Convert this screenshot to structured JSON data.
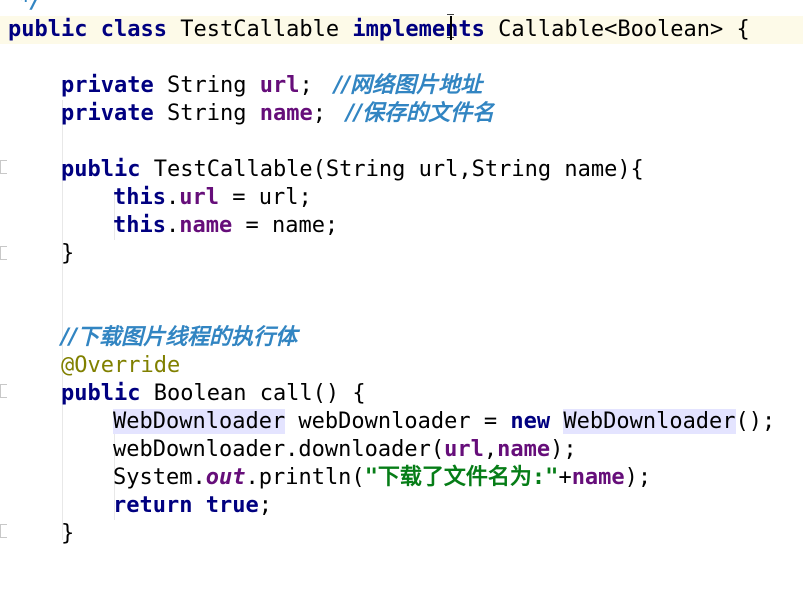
{
  "editor": {
    "lines": {
      "l0": {
        "cmt": "*/"
      },
      "l1": {
        "kw1": "public",
        "kw2": "class",
        "name": "TestCallable",
        "kw3": "implements",
        "rest": "Callable<Boolean> {"
      },
      "l2": {
        "kw": "private",
        "type": "String",
        "field": "url",
        "semi": ";",
        "cmt": "//网络图片地址"
      },
      "l3": {
        "kw": "private",
        "type": "String",
        "field": "name",
        "semi": ";",
        "cmt": "//保存的文件名"
      },
      "l4": {
        "kw": "public",
        "rest": "TestCallable(String url,String name){"
      },
      "l5": {
        "kw": "this",
        "dot": ".",
        "field": "url",
        "rest": " = url;"
      },
      "l6": {
        "kw": "this",
        "dot": ".",
        "field": "name",
        "rest": " = name;"
      },
      "l7": {
        "brace": "}"
      },
      "l8": {
        "cmt": "//下载图片线程的执行体"
      },
      "l9": {
        "ann": "@Override"
      },
      "l10": {
        "kw": "public",
        "rest": "Boolean call() {"
      },
      "l11": {
        "t1": "WebDownloader",
        "mid": " webDownloader = ",
        "kw": "new",
        "t2": "WebDownloader",
        "end": "();"
      },
      "l12": {
        "pre": "webDownloader.downloader(",
        "f1": "url",
        "comma": ",",
        "f2": "name",
        "end": ");"
      },
      "l13": {
        "pre": "System.",
        "stat": "out",
        "mid": ".println(",
        "str": "\"下载了文件名为:\"",
        "plus": "+",
        "field": "name",
        "end": ");"
      },
      "l14": {
        "kw1": "return",
        "kw2": "true",
        "end": ";"
      },
      "l15": {
        "brace": "}"
      }
    }
  }
}
